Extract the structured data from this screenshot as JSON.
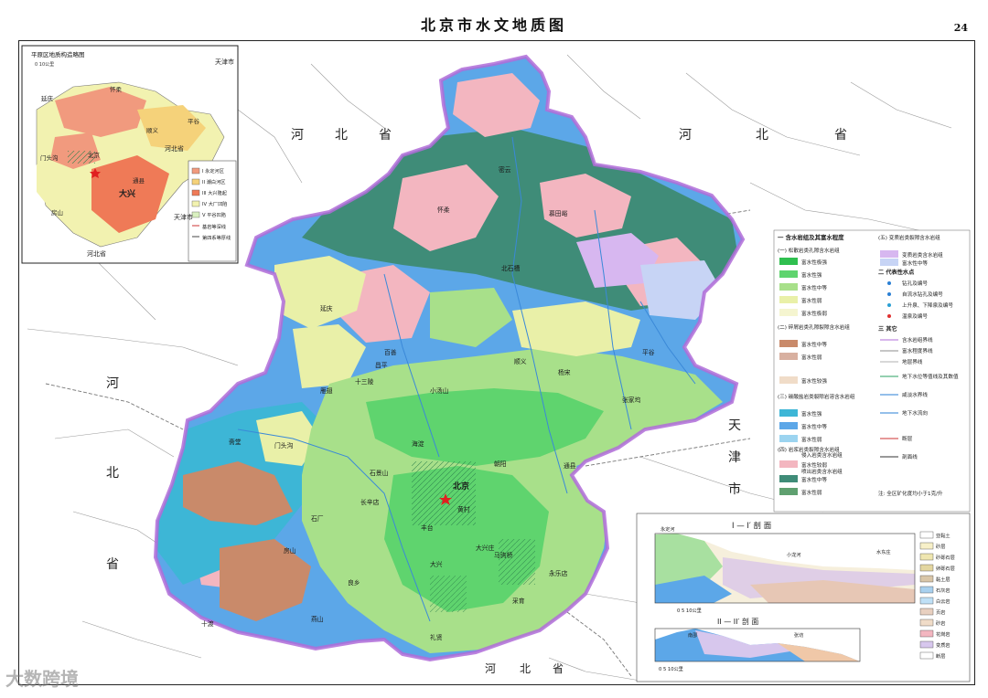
{
  "title": "北京市水文地质图",
  "page_number": "24",
  "watermark": "大数跨境",
  "colors": {
    "water_rich": "#5fd46e",
    "water_medium": "#a8e08a",
    "water_poor": "#e9f0a8",
    "karst": "#3f8c78",
    "karst_medium": "#3db6d6",
    "karst_blue": "#5ca7e8",
    "granite": "#f3b6c0",
    "clastic": "#c98a6a",
    "volcanic": "#d7b7f0",
    "boundary": "#b06cd8",
    "river": "#3a89d8"
  },
  "inset": {
    "title": "平原区地质构造略图",
    "scale": "0   10公里",
    "labels": [
      "北京",
      "大兴",
      "怀柔",
      "通县",
      "顺义",
      "平谷",
      "门头沟",
      "房山",
      "延庆",
      "河北省",
      "河北省",
      "天津市",
      "天津市"
    ],
    "legend": [
      "I  永定河区",
      "II 潮白河区",
      "III 大兴隆起",
      "IV 大厂凹陷",
      "V  平谷凹陷",
      "基岩等深线",
      "第四系等厚线"
    ]
  },
  "map_labels": {
    "beijing": "北京",
    "provinces": [
      "河",
      "北",
      "省",
      "河",
      "北",
      "省",
      "河",
      "北",
      "省",
      "河",
      "北",
      "省",
      "天",
      "津",
      "市"
    ],
    "places": [
      "密云",
      "怀柔",
      "延庆",
      "昌平",
      "顺义",
      "平谷",
      "通县",
      "大兴",
      "房山",
      "门头沟",
      "丰台",
      "海淀",
      "朝阳",
      "石景山",
      "十三陵",
      "慕田峪",
      "十渡",
      "良乡",
      "采育",
      "礼贤",
      "黄村",
      "长辛店",
      "石厂",
      "燕山",
      "马驹桥",
      "永乐店",
      "小汤山",
      "百善",
      "杨宋",
      "北石槽",
      "大兴庄",
      "张家坞",
      "斋堂",
      "雁翅"
    ]
  },
  "legend": {
    "heading_1": "一 含水岩组及其富水程度",
    "group_1": "(一) 松散岩类孔隙含水岩组",
    "group_1_items": [
      "富水性极强",
      "富水性强",
      "富水性中等",
      "富水性弱",
      "富水性极弱"
    ],
    "group_2": "(二) 碎屑岩类孔隙裂隙含水岩组",
    "group_2_items": [
      "富水性中等",
      "富水性弱",
      "富水性较强"
    ],
    "group_3": "(三) 碳酸盐岩类裂隙岩溶含水岩组",
    "group_3_items": [
      "富水性强",
      "富水性中等",
      "富水性弱"
    ],
    "group_4": "(四) 岩浆岩类裂隙含水岩组",
    "group_4_items": [
      "侵入岩类含水岩组",
      "富水性较弱",
      "喷出岩类含水岩组",
      "富水性中等",
      "富水性弱"
    ],
    "heading_5": "(五) 变质岩类裂隙含水岩组",
    "group_5_items": [
      "变质岩类含水岩组",
      "富水性中等"
    ],
    "heading_2": "二 代表性水点",
    "points": [
      "钻孔及编号",
      "自流水钻孔及编号",
      "上升泉、下降泉及编号",
      "温泉及编号"
    ],
    "heading_3": "三 其它",
    "others": [
      "含水岩组界线",
      "富水程度界线",
      "地层界线",
      "地下水位等值线及其数值",
      "咸淡水界线",
      "地下水流向",
      "断层",
      "剖面线"
    ],
    "note": "注: 全区矿化度均小于1克/升"
  },
  "sections": {
    "s1_title": "I — I′ 剖 面",
    "s2_title": "II — II′ 剖 面",
    "s1_labels": [
      "永定河",
      "小龙河",
      "水东庄"
    ],
    "s1_scale": "0   5   10公里",
    "s2_labels": [
      "南邵",
      "张坊"
    ],
    "s2_scale": "0 5 10公里",
    "section_legend": [
      "亚黏土",
      "砂层",
      "砂砾石层",
      "卵砾石层",
      "黏土层",
      "石灰岩",
      "白云岩",
      "页岩",
      "砂岩",
      "花岗岩",
      "变质岩",
      "断层"
    ]
  }
}
